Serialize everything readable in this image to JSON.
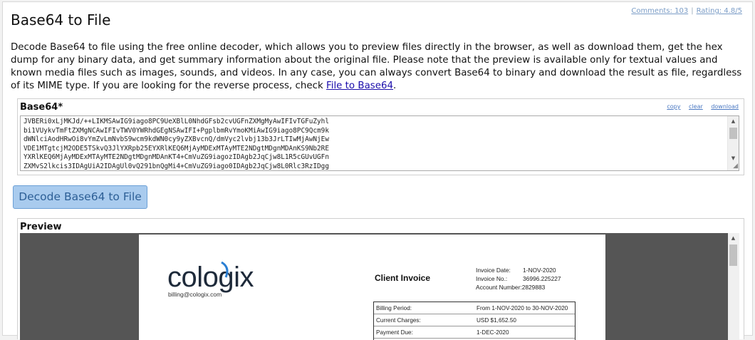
{
  "page": {
    "title": "Base64 to File",
    "comments": "Comments: 103",
    "rating": "Rating: 4.8/5",
    "description_text": "Decode Base64 to file using the free online decoder, which allows you to preview files directly in the browser, as well as download them, get the hex dump for any binary data, and get summary information about the original file. Please note that the preview is available only for textual values and known media files such as images, sounds, and videos. In any case, you can always convert Base64 to binary and download the result as file, regardless of its MIME type. If you are looking for the reverse process, check ",
    "description_link": "File to Base64",
    "description_end": "."
  },
  "base64_box": {
    "label": "Base64*",
    "tools": [
      "copy",
      "clear",
      "download"
    ],
    "value_lines": [
      "JVBERi0xLjMKJd/++LIKMSAwIG9iago8PC9UeXBlL0NhdGFsb2cvUGFnZXMgMyAwIFIvTGFuZyhl",
      "bi1VUykvTmFtZXMgNCAwIFIvTWV0YWRhdGEgNSAwIFI+PgplbmRvYmoKMiAwIG9iago8PC9Qcm9k",
      "dWNlciAodHRwOi8vYmZvLmNvbS9wcm9kdWN0cy9yZXBvcnQ/dmVyc2lvbj13b3JrLTIwMjAwNjEw",
      "VDE1MTgtcjM2ODE5TSkvQ3JlYXRpb25EYXRlKEQ6MjAyMDExMTAyMTE2NDgtMDgnMDAnKS9Nb2RE",
      "YXRlKEQ6MjAyMDExMTAyMTE2NDgtMDgnMDAnKT4+CmVuZG9iagozIDAgb2JqCjw8L1R5cGUvUGFn",
      "ZXMvS2lkcis3IDAgUiA2IDAgUl0vQ291bnQgMi4+CmVuZG9iago0IDAgb2JqCjw8L0Rlc3RzIDgg"
    ]
  },
  "decode_button": {
    "label": "Decode Base64 to File"
  },
  "preview": {
    "label": "Preview",
    "invoice": {
      "logo_text_a": "cologi",
      "logo_text_b": "x",
      "email": "billing@cologix.com",
      "title": "Client Invoice",
      "meta": [
        {
          "label": "Invoice Date:",
          "value": "1-NOV-2020"
        },
        {
          "label": "Invoice No.:",
          "value": "36996.225227"
        },
        {
          "label": "Account Number:",
          "value": "2829883"
        }
      ],
      "billing": [
        {
          "label": "Billing Period:",
          "value": "From 1-NOV-2020 to 30-NOV-2020"
        },
        {
          "label": "Current Charges:",
          "value": "USD $1,652.50"
        },
        {
          "label": "Payment Due:",
          "value": "1-DEC-2020"
        }
      ]
    }
  },
  "colors": {
    "button_bg": "#a9cbee",
    "button_text": "#2d5f96",
    "link": "#1a0dab",
    "meta_link": "#7a9cc6",
    "preview_bg": "#555555"
  }
}
